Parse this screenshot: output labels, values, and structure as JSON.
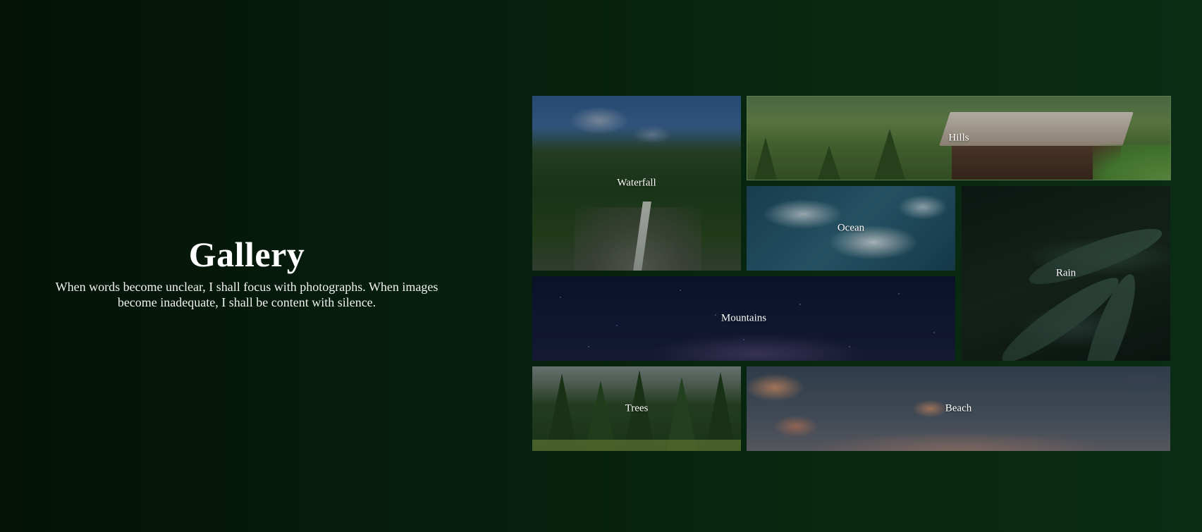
{
  "hero": {
    "title": "Gallery",
    "description": "When words become unclear, I shall focus with photographs. When images become inadequate, I shall be content with silence."
  },
  "gallery": {
    "tiles": [
      {
        "label": "Waterfall"
      },
      {
        "label": "Hills"
      },
      {
        "label": "Ocean"
      },
      {
        "label": "Rain"
      },
      {
        "label": "Mountains"
      },
      {
        "label": "Trees"
      },
      {
        "label": "Beach"
      }
    ]
  },
  "colors": {
    "background_dark": "#041207",
    "background_green": "#0b2d14",
    "text": "#ffffff"
  }
}
